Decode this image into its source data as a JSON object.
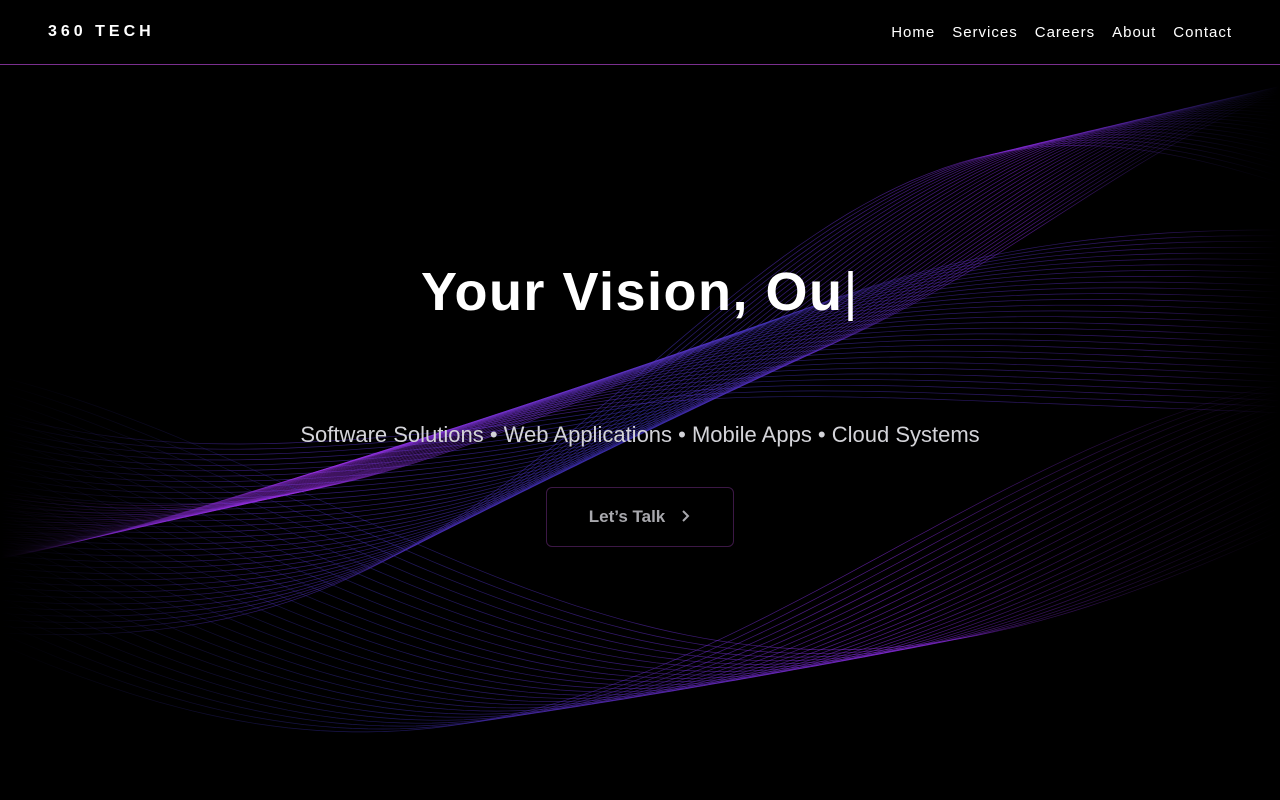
{
  "header": {
    "logo": "360 TECH",
    "nav": [
      {
        "label": "Home"
      },
      {
        "label": "Services"
      },
      {
        "label": "Careers"
      },
      {
        "label": "About"
      },
      {
        "label": "Contact"
      }
    ]
  },
  "hero": {
    "headline": "Your Vision, Ou",
    "cursor": "|",
    "tagline": "Software Solutions • Web Applications • Mobile Apps • Cloud Systems",
    "cta_label": "Let’s Talk",
    "cta_icon": "chevron-right-icon"
  },
  "colors": {
    "background": "#000000",
    "accent": "#7a2f8f",
    "wave_blue": "#3a2fb0",
    "wave_purple": "#8a2be2"
  }
}
